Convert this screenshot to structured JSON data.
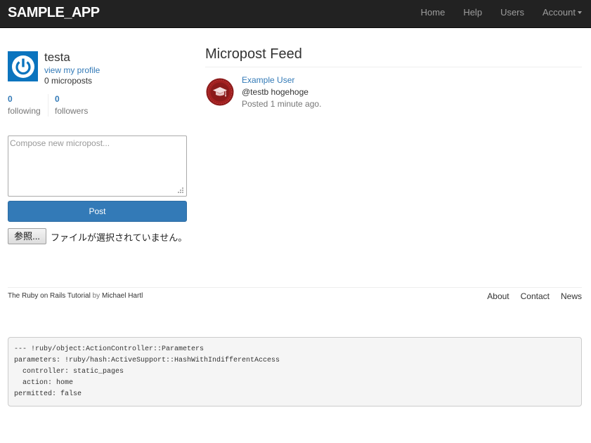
{
  "navbar": {
    "brand": "SAMPLE_APP",
    "links": [
      "Home",
      "Help",
      "Users"
    ],
    "account": "Account"
  },
  "sidebar": {
    "user_name": "testa",
    "profile_link": "view my profile",
    "micropost_count": "0 microposts",
    "stats": {
      "following_count": "0",
      "following_label": "following",
      "followers_count": "0",
      "followers_label": "followers"
    },
    "avatar_icon": "power-icon",
    "avatar_color": "#0b74be"
  },
  "composer": {
    "placeholder": "Compose new micropost...",
    "value": "",
    "post_button": "Post",
    "file_button": "参照...",
    "file_status": "ファイルが選択されていません。"
  },
  "feed": {
    "title": "Micropost Feed",
    "items": [
      {
        "user": "Example User",
        "content": "@testb hogehoge",
        "timestamp": "Posted 1 minute ago.",
        "avatar_icon": "graduation-cap-badge-icon",
        "avatar_color": "#8b1a1a"
      }
    ]
  },
  "footer": {
    "tutorial_link": "The Ruby on Rails Tutorial",
    "by": "by",
    "author_link": "Michael Hartl",
    "links": [
      "About",
      "Contact",
      "News"
    ]
  },
  "debug": {
    "text": "--- !ruby/object:ActionController::Parameters\nparameters: !ruby/hash:ActiveSupport::HashWithIndifferentAccess\n  controller: static_pages\n  action: home\npermitted: false"
  },
  "colors": {
    "navbar_bg": "#222222",
    "link": "#337ab7",
    "primary_button": "#337ab7"
  }
}
